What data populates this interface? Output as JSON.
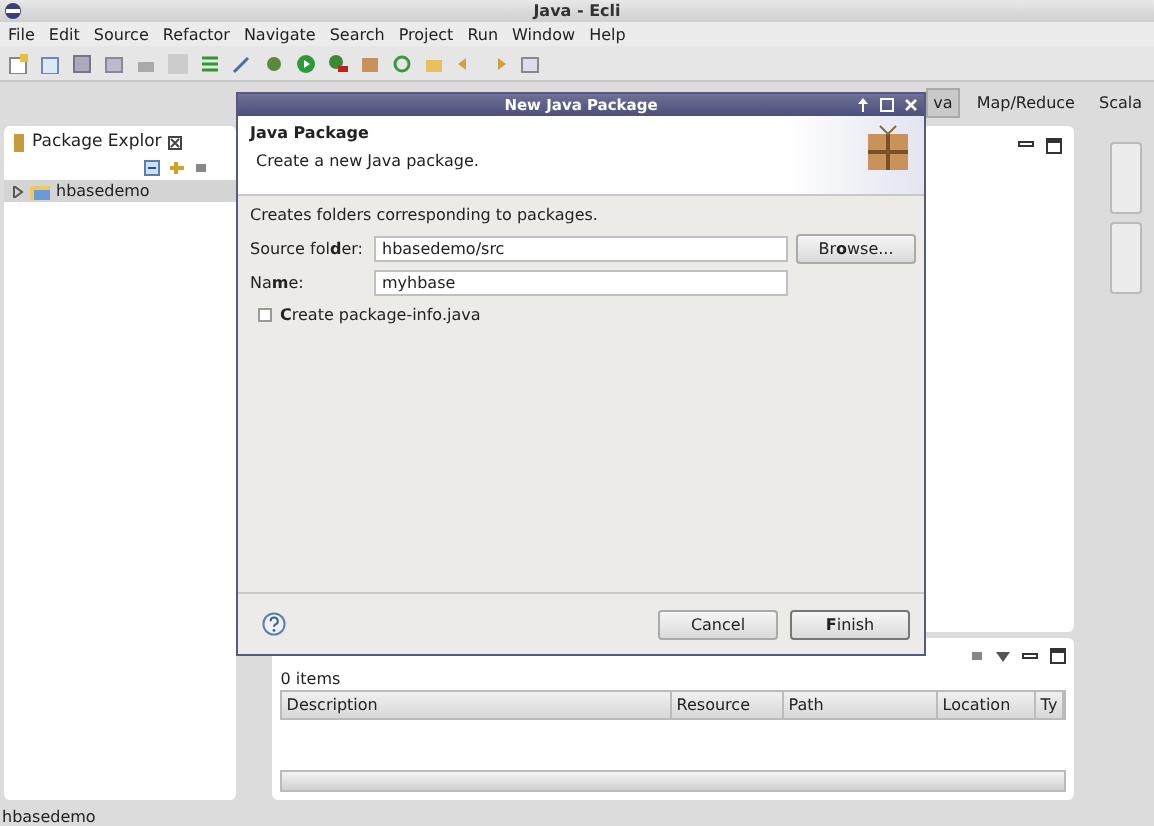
{
  "window": {
    "title": "Java - Ecli"
  },
  "menu": [
    "File",
    "Edit",
    "Source",
    "Refactor",
    "Navigate",
    "Search",
    "Project",
    "Run",
    "Window",
    "Help"
  ],
  "perspectives": [
    {
      "label": "va",
      "selected": true
    },
    {
      "label": "Map/Reduce",
      "selected": false
    },
    {
      "label": "Scala",
      "selected": false
    }
  ],
  "package_explorer": {
    "title": "Package Explor",
    "tree": [
      {
        "label": "hbasedemo",
        "selected": true,
        "expanded": false
      }
    ]
  },
  "problems": {
    "count": "0 items",
    "columns": [
      "Description",
      "Resource",
      "Path",
      "Location",
      "Ty"
    ]
  },
  "status_bar": "hbasedemo",
  "dialog": {
    "title": "New Java Package",
    "heading": "Java Package",
    "message": "Create a new Java package.",
    "intro": "Creates folders corresponding to packages.",
    "fields": [
      {
        "label": "Source fol**d**er:",
        "value": "hbasedemo/src",
        "button": "Br**o**wse..."
      },
      {
        "label": "Na**m**e:",
        "value": "myhbase"
      }
    ],
    "checkbox": {
      "label": "**C**reate package-info.java",
      "checked": false
    },
    "buttons": [
      {
        "label": "Cancel",
        "kind": "normal"
      },
      {
        "label": "**F**inish",
        "kind": "default"
      }
    ]
  }
}
